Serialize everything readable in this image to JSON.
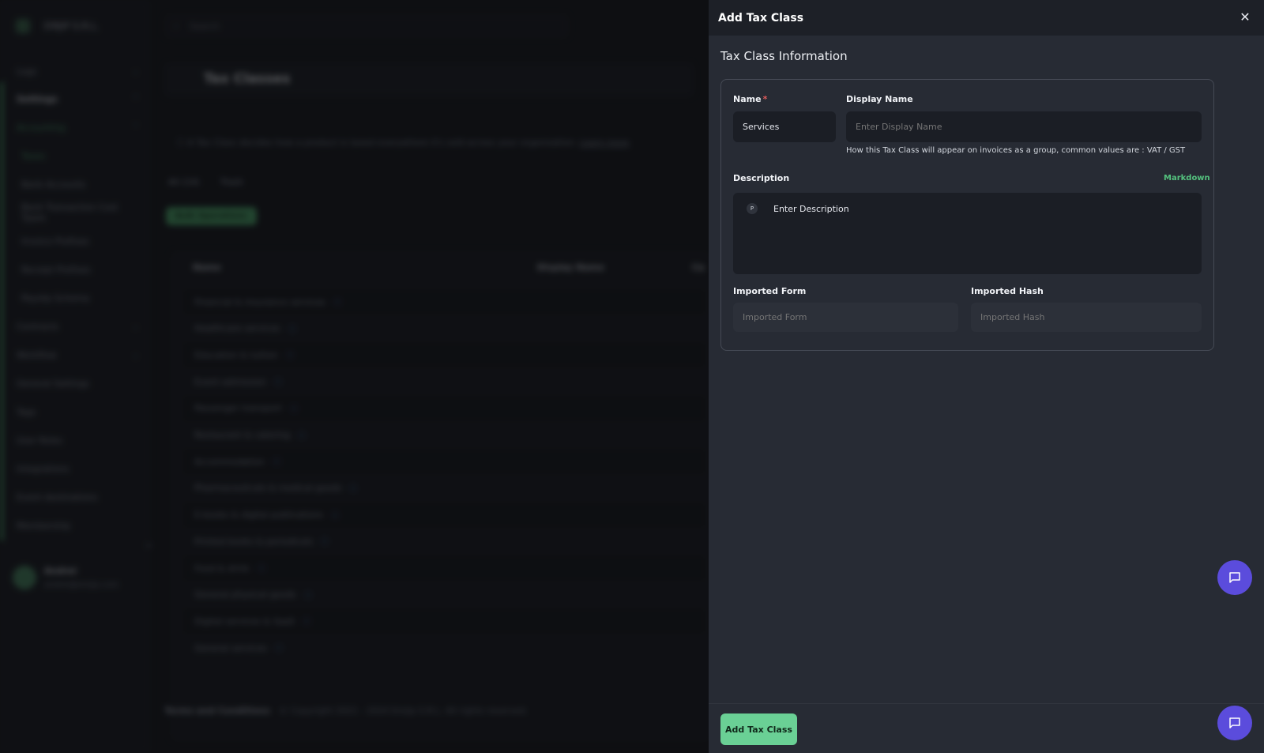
{
  "background": {
    "brand": "EMJIP S.R.L.",
    "search_placeholder": "Search",
    "sidebar": [
      {
        "label": "Logs",
        "chevron": "v"
      },
      {
        "label": "Settings",
        "chevron": "^"
      },
      {
        "label": "Accounting",
        "chevron": "^"
      },
      {
        "label": "Taxes"
      },
      {
        "label": "Bank Accounts"
      },
      {
        "label": "Bank Transaction Cost Types"
      },
      {
        "label": "Invoice Prefixes"
      },
      {
        "label": "Receipt Prefixes"
      },
      {
        "label": "Payslip Schema"
      },
      {
        "label": "Contracts",
        "chevron": "v"
      },
      {
        "label": "Workflow",
        "chevron": "v"
      },
      {
        "label": "General Settings"
      },
      {
        "label": "Tags"
      },
      {
        "label": "User Roles"
      },
      {
        "label": "Integrations"
      },
      {
        "label": "Event destinations"
      },
      {
        "label": "Membership"
      }
    ],
    "user": {
      "name": "Andrei",
      "email": "andrei@emjip.com"
    },
    "page_title": "Tax Classes",
    "info": "A Tax Class decides how a product is taxed everywhere it's sold across your organization.",
    "info_link": "Learn more",
    "toolbar": {
      "export": "All (14)",
      "trash": "Trash"
    },
    "bulk_label": "Bulk Operations",
    "table_headers": [
      "Name",
      "Display Name",
      "Ca"
    ],
    "rows": [
      "Financial & insurance services",
      "Healthcare services",
      "Education & tuition",
      "Event admission",
      "Passenger transport",
      "Restaurant & catering",
      "Accommodation",
      "Pharmaceuticals & medical goods",
      "E-books & digital publications",
      "Printed books & periodicals",
      "Food & drink",
      "General physical goods",
      "Digital services & SaaS",
      "General services"
    ],
    "footer_link": "Terms and Conditions",
    "footer_text": "© Copyright 2021 - 2024 Emjip S.R.L. All rights reserved."
  },
  "drawer": {
    "title": "Add Tax Class",
    "section_title": "Tax Class Information",
    "name_label": "Name",
    "required_mark": "*",
    "name_value": "Services",
    "display_name_label": "Display Name",
    "display_name_placeholder": "Enter Display Name",
    "display_name_hint": "How this Tax Class will appear on invoices as a group, common values are : VAT / GST",
    "description_label": "Description",
    "markdown_label": "Markdown",
    "paragraph_badge": "P",
    "description_placeholder": "Enter Description",
    "imported_form_label": "Imported Form",
    "imported_form_placeholder": "Imported Form",
    "imported_hash_label": "Imported Hash",
    "imported_hash_placeholder": "Imported Hash",
    "submit_label": "Add Tax Class",
    "close_icon": "close-icon"
  },
  "colors": {
    "accent_green": "#6ad095",
    "link_green": "#54c27e",
    "chat_purple": "#5b4cdc",
    "required_red": "#e05b5b"
  }
}
